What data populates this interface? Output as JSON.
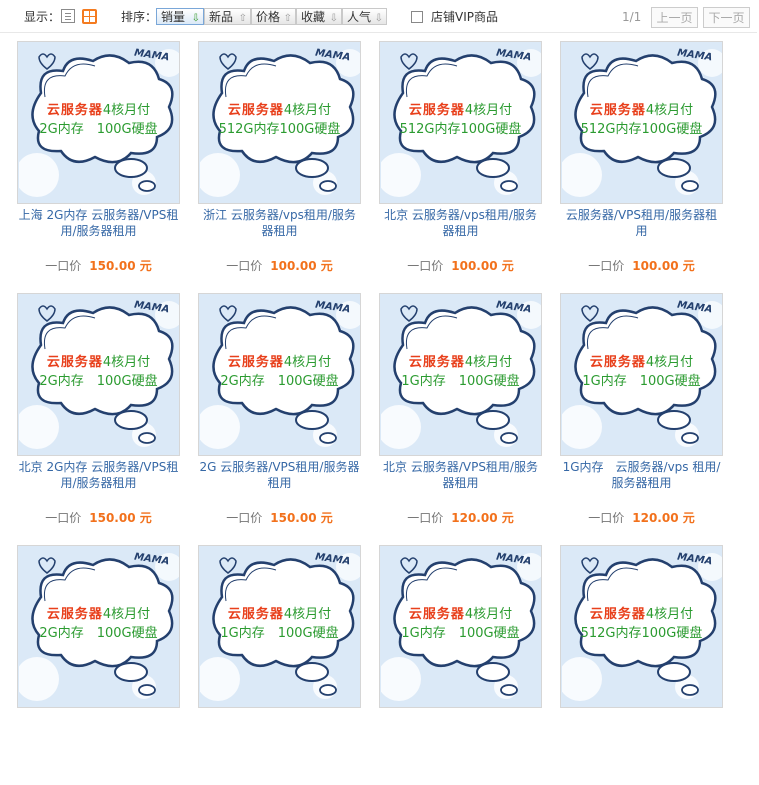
{
  "toolbar": {
    "display_label": "显示：",
    "sort_label": "排序：",
    "sorts": [
      {
        "label": "销量",
        "arrow": "⇩",
        "active": true
      },
      {
        "label": "新品",
        "arrow": "⇧",
        "active": false
      },
      {
        "label": "价格",
        "arrow": "⇧",
        "active": false
      },
      {
        "label": "收藏",
        "arrow": "⇩",
        "active": false
      },
      {
        "label": "人气",
        "arrow": "⇩",
        "active": false
      }
    ],
    "vip_label": "店铺VIP商品",
    "page_info": "1/1",
    "prev_label": "上一页",
    "next_label": "下一页"
  },
  "thumb_common": {
    "mama": "MAMA",
    "line1_a": "云服务器",
    "line1_b": "4核月付"
  },
  "price_label": "一口价",
  "products": [
    {
      "line2": "2G内存　100G硬盘",
      "title": "上海 2G内存 云服务器/VPS租用/服务器租用",
      "price": "150.00 元"
    },
    {
      "line2": "512G内存100G硬盘",
      "title": "浙江 云服务器/vps租用/服务器租用",
      "price": "100.00 元"
    },
    {
      "line2": "512G内存100G硬盘",
      "title": "北京 云服务器/vps租用/服务器租用",
      "price": "100.00 元"
    },
    {
      "line2": "512G内存100G硬盘",
      "title": "云服务器/VPS租用/服务器租用",
      "price": "100.00 元"
    },
    {
      "line2": "2G内存　100G硬盘",
      "title": "北京 2G内存 云服务器/VPS租用/服务器租用",
      "price": "150.00 元"
    },
    {
      "line2": "2G内存　100G硬盘",
      "title": "2G 云服务器/VPS租用/服务器租用",
      "price": "150.00 元"
    },
    {
      "line2": "1G内存　100G硬盘",
      "title": "北京 云服务器/VPS租用/服务器租用",
      "price": "120.00 元"
    },
    {
      "line2": "1G内存　100G硬盘",
      "title": "1G内存　云服务器/vps 租用/服务器租用",
      "price": "120.00 元"
    },
    {
      "line2": "2G内存　100G硬盘",
      "title": "",
      "price": ""
    },
    {
      "line2": "1G内存　100G硬盘",
      "title": "",
      "price": ""
    },
    {
      "line2": "1G内存　100G硬盘",
      "title": "",
      "price": ""
    },
    {
      "line2": "512G内存100G硬盘",
      "title": "",
      "price": ""
    }
  ]
}
